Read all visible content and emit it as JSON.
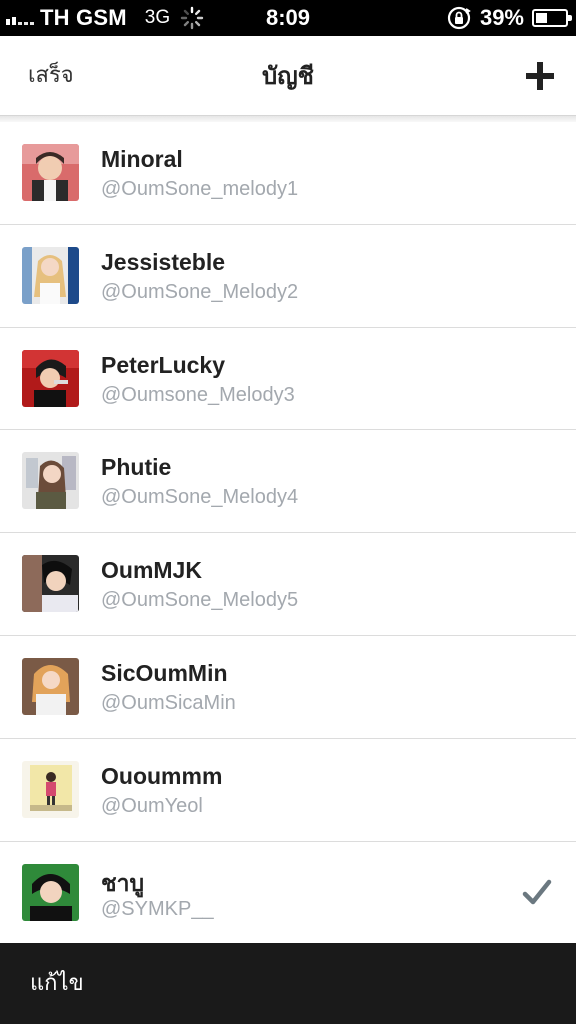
{
  "status_bar": {
    "carrier": "TH GSM",
    "network": "3G",
    "time": "8:09",
    "battery": "39%",
    "battery_level": 0.39
  },
  "nav": {
    "done_label": "เสร็จ",
    "title": "บัญชี",
    "add_icon": "plus-icon"
  },
  "accounts": [
    {
      "name": "Minoral",
      "handle": "@OumSone_melody1",
      "selected": false
    },
    {
      "name": "Jessisteble",
      "handle": "@OumSone_Melody2",
      "selected": false
    },
    {
      "name": "PeterLucky",
      "handle": "@Oumsone_Melody3",
      "selected": false
    },
    {
      "name": "Phutie",
      "handle": "@OumSone_Melody4",
      "selected": false
    },
    {
      "name": "OumMJK",
      "handle": "@OumSone_Melody5",
      "selected": false
    },
    {
      "name": "SicOumMin",
      "handle": "@OumSicaMin",
      "selected": false
    },
    {
      "name": "Ouoummm",
      "handle": "@OumYeol",
      "selected": false
    },
    {
      "name": "ชาบู",
      "handle": "@SYMKP__",
      "selected": true
    }
  ],
  "bottom": {
    "edit_label": "แก้ไข"
  },
  "colors": {
    "handle": "#a3a8ae",
    "bottom_bar": "#1a1a1a",
    "check": "#6b7880"
  }
}
